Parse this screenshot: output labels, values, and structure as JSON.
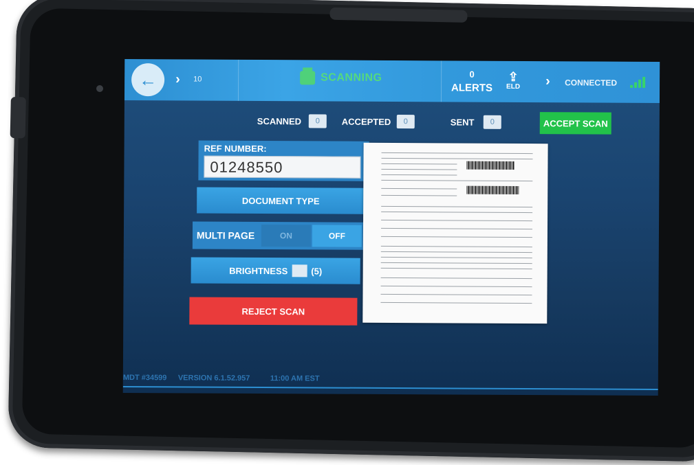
{
  "header": {
    "count": "10",
    "title": "SCANNING",
    "alerts_count": "0",
    "alerts_label": "ALERTS",
    "eld_label": "ELD",
    "status": "CONNECTED"
  },
  "counters": {
    "scanned_label": "SCANNED",
    "scanned_value": "0",
    "accepted_label": "ACCEPTED",
    "accepted_value": "0",
    "sent_label": "SENT",
    "sent_value": "0"
  },
  "actions": {
    "accept_label": "ACCEPT SCAN",
    "document_type_label": "DOCUMENT TYPE",
    "brightness_label": "BRIGHTNESS",
    "brightness_value": "(5)",
    "reject_label": "REJECT SCAN"
  },
  "ref": {
    "label": "REF NUMBER:",
    "value": "01248550"
  },
  "multipage": {
    "label": "MULTI PAGE",
    "on_label": "ON",
    "off_label": "OFF"
  },
  "footer": {
    "device": "MDT #34599",
    "version": "VERSION 6.1.52.957",
    "time": "11:00 AM EST"
  },
  "colors": {
    "accent": "#3ba4e6",
    "accept": "#22c24a",
    "reject": "#ea3b3b",
    "signal": "#38d36b"
  }
}
